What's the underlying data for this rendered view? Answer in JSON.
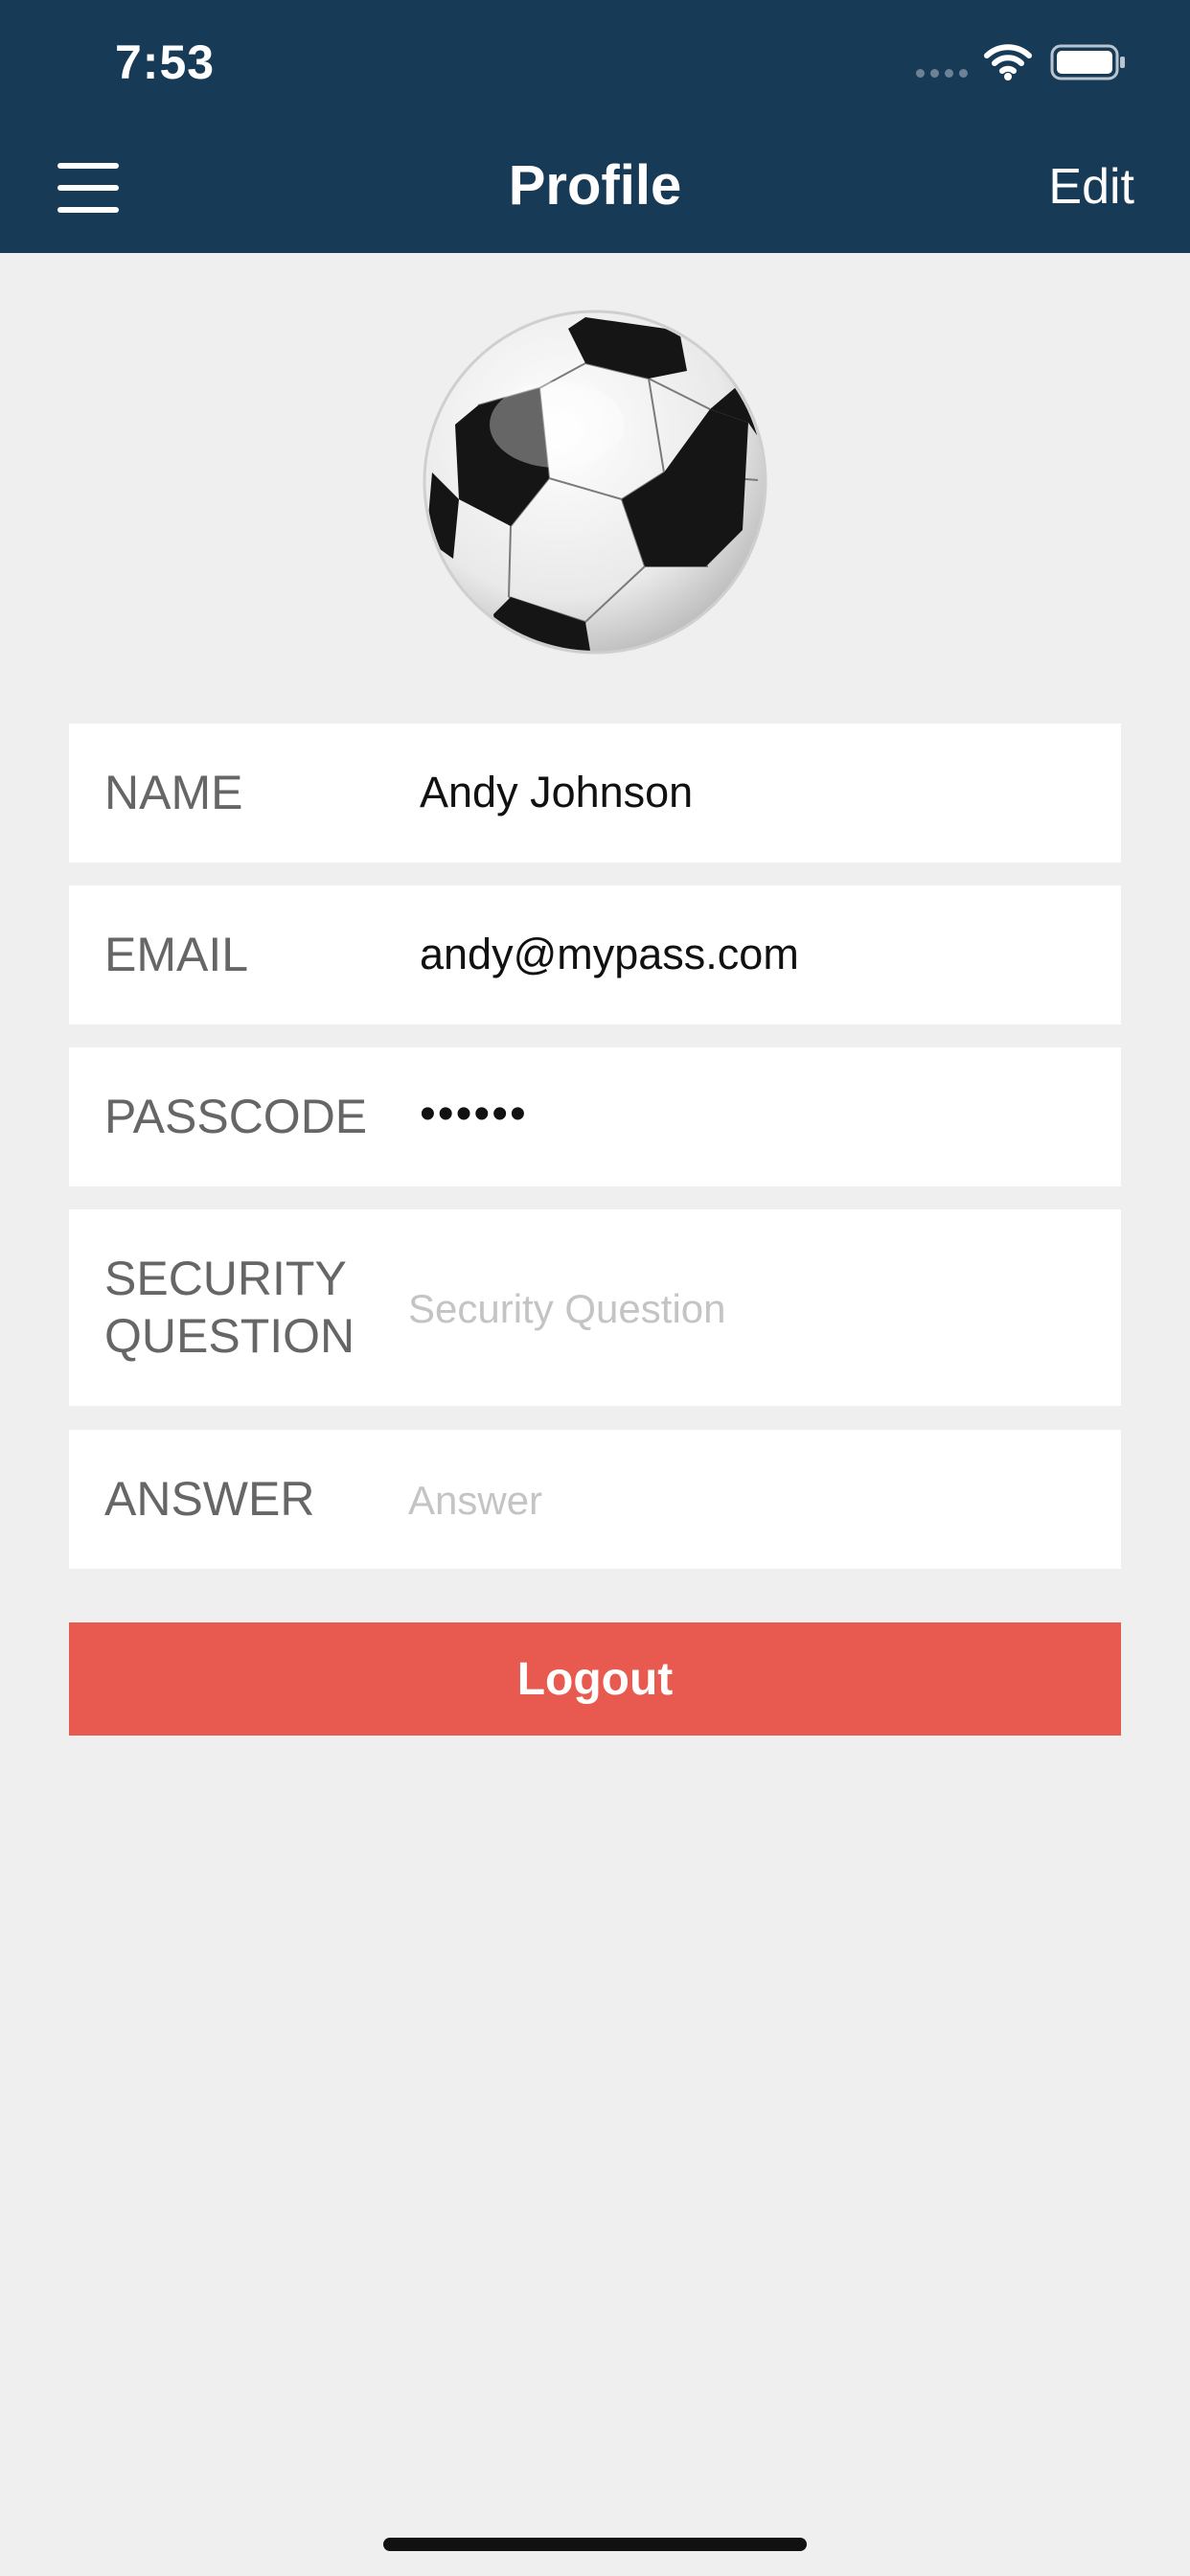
{
  "status_bar": {
    "time": "7:53"
  },
  "header": {
    "title": "Profile",
    "edit_label": "Edit"
  },
  "avatar": {
    "icon": "soccer-ball-icon"
  },
  "form": {
    "name": {
      "label": "NAME",
      "value": "Andy Johnson"
    },
    "email": {
      "label": "EMAIL",
      "value": "andy@mypass.com"
    },
    "passcode": {
      "label": "PASSCODE",
      "value": "••••••"
    },
    "security_question": {
      "label_line1": "SECURITY",
      "label_line2": "QUESTION",
      "placeholder": "Security Question"
    },
    "answer": {
      "label": "ANSWER",
      "placeholder": "Answer"
    }
  },
  "logout_label": "Logout",
  "colors": {
    "header": "#173b57",
    "logout": "#e85a4f",
    "background": "#efefef"
  }
}
